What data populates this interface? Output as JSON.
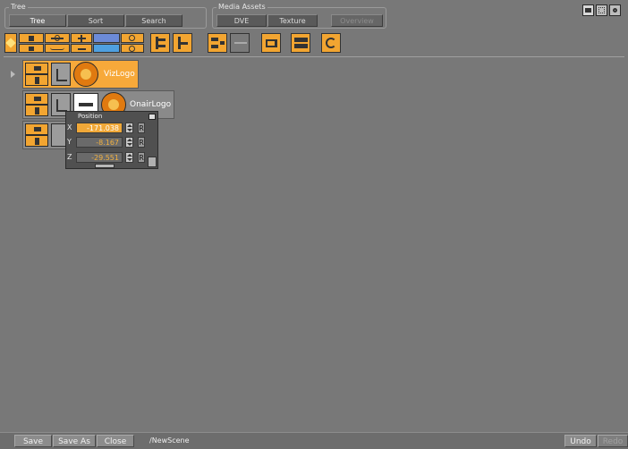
{
  "tree_group": {
    "title": "Tree",
    "tabs": [
      {
        "label": "Tree",
        "active": true
      },
      {
        "label": "Sort",
        "active": false
      },
      {
        "label": "Search",
        "active": false
      }
    ]
  },
  "media_group": {
    "title": "Media Assets",
    "tabs": [
      {
        "label": "DVE",
        "active": false
      },
      {
        "label": "Texture",
        "active": false
      },
      {
        "label": "Overview",
        "active": false,
        "disabled": true
      }
    ]
  },
  "window_icons": [
    "monitor-icon",
    "grid-icon",
    "settings-icon"
  ],
  "toolbar": {
    "icons": [
      "favorite-star-icon",
      "merge-container-icon",
      "split-container-icon",
      "add-container-icon",
      "remove-container-icon",
      "image-icon",
      "zoom-in-icon",
      "zoom-out-icon",
      "tree-expand-icon",
      "tree-collapse-icon",
      "hierarchy-icon",
      "graph-icon",
      "export-icon",
      "align-icon",
      "refresh-icon"
    ]
  },
  "scene_tree": {
    "nodes": [
      {
        "label": "VizLogo",
        "selected": true
      },
      {
        "label": "OnairLogo",
        "selected": false
      },
      {
        "label": "",
        "selected": false
      }
    ]
  },
  "position_panel": {
    "title": "Position",
    "axes": [
      {
        "axis": "X",
        "value": "-171.038",
        "reset": "R",
        "selected": true
      },
      {
        "axis": "Y",
        "value": "-8.167",
        "reset": "R",
        "selected": false
      },
      {
        "axis": "Z",
        "value": "-29.551",
        "reset": "R",
        "selected": false
      }
    ]
  },
  "bottom_bar": {
    "save": "Save",
    "save_as": "Save As",
    "close": "Close",
    "scene_path": "/NewScene",
    "undo": "Undo",
    "redo": "Redo"
  },
  "colors": {
    "background": "#787878",
    "selected_orange": "#f7a93a",
    "value_text": "#f0b040"
  }
}
